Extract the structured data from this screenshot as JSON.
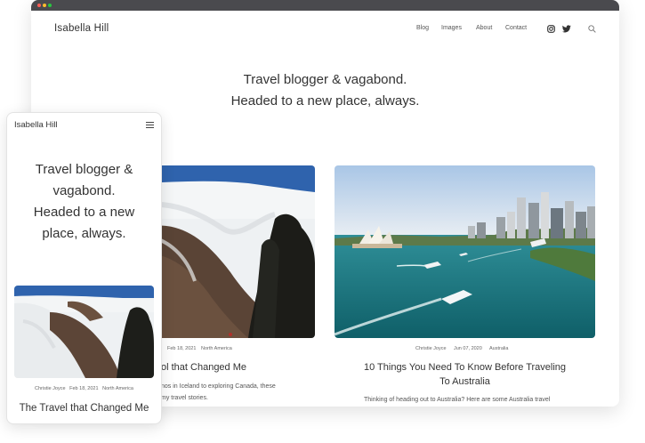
{
  "desktop": {
    "brand": "Isabella Hill",
    "nav": [
      "Blog",
      "Images",
      "About",
      "Contact"
    ],
    "hero_line1": "Travel blogger & vagabond.",
    "hero_line2": "Headed to a new place, always.",
    "posts": [
      {
        "author": "",
        "date": "Feb 18, 2021",
        "category": "North America",
        "title": "ol that Changed Me",
        "excerpt_line1": "nos in Iceland to exploring Canada, these",
        "excerpt_line2": "my travel stories."
      },
      {
        "author": "Christie Joyce",
        "date": "Jun 07, 2020",
        "category": "Australia",
        "title_line1": "10 Things You Need To Know Before Traveling",
        "title_line2": "To Australia",
        "excerpt": "Thinking of heading out to Australia? Here are some Australia travel"
      }
    ]
  },
  "mobile": {
    "brand": "Isabella Hill",
    "hero_lines": [
      "Travel blogger &",
      "vagabond.",
      "Headed to a new",
      "place, always."
    ],
    "post": {
      "author": "Christie Joyce",
      "date": "Feb 18, 2021",
      "category": "North America",
      "title": "The Travel that Changed Me"
    }
  },
  "icons": [
    "instagram-icon",
    "twitter-icon",
    "search-icon",
    "menu-icon"
  ]
}
